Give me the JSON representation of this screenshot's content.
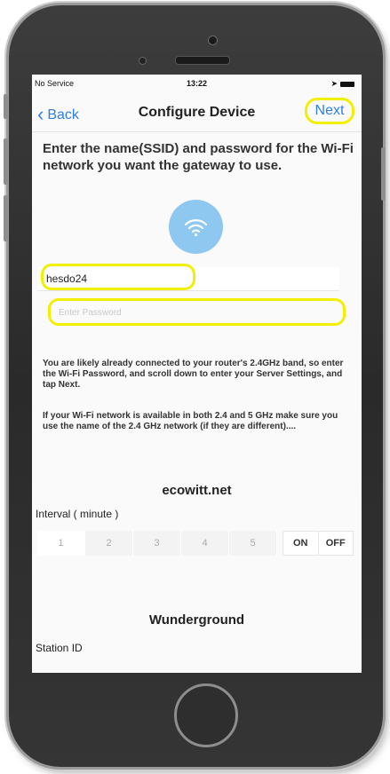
{
  "status_bar": {
    "carrier": "No Service",
    "time": "13:22"
  },
  "nav": {
    "back_label": "Back",
    "title": "Configure Device",
    "next_label": "Next"
  },
  "intro": "Enter the name(SSID) and password for the Wi-Fi network you want the gateway to use.",
  "form": {
    "ssid_value": "hesdo24",
    "password_placeholder": "Enter Password"
  },
  "info": {
    "paragraph1": "You are likely already connected to your router's 2.4GHz band, so enter the Wi-Fi Password, and scroll down to enter your Server Settings, and tap Next.",
    "paragraph2": "If your Wi-Fi network is available in both 2.4 and 5 GHz make sure you use the name of the 2.4 GHz network (if they are different)...."
  },
  "ecowitt": {
    "title": "ecowitt.net",
    "interval_label": "Interval ( minute )",
    "interval_options": [
      "1",
      "2",
      "3",
      "4",
      "5"
    ],
    "toggle_on": "ON",
    "toggle_off": "OFF"
  },
  "wunderground": {
    "title": "Wunderground",
    "station_id_label": "Station ID"
  },
  "colors": {
    "accent": "#2f7fe0",
    "highlight": "#f2f000",
    "wifi_circle": "#8ec7ef"
  },
  "icons": {
    "back": "chevron-left-icon",
    "wifi": "wifi-icon"
  }
}
